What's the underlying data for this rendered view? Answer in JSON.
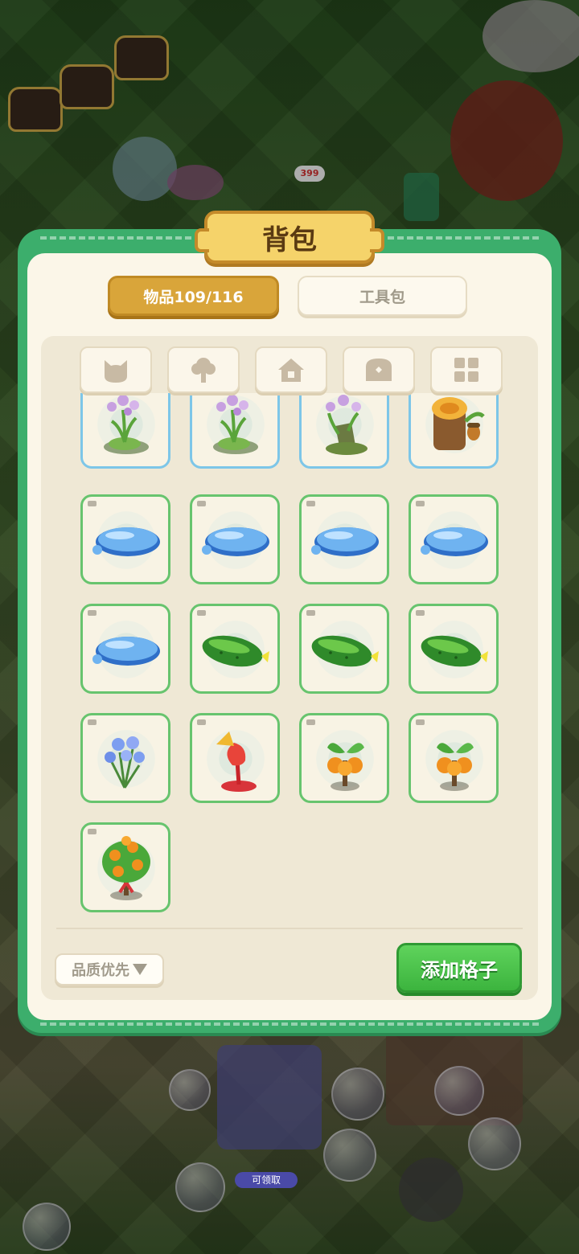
{
  "scene": {
    "price_tag": "399",
    "claim_label": "可领取"
  },
  "panel": {
    "title": "背包",
    "tabs": [
      {
        "label": "物品109/116",
        "active": true
      },
      {
        "label": "工具包",
        "active": false
      }
    ],
    "filters": [
      {
        "icon": "cat-icon"
      },
      {
        "icon": "tree-icon"
      },
      {
        "icon": "house-icon"
      },
      {
        "icon": "chest-icon"
      },
      {
        "icon": "grid-icon"
      }
    ],
    "items": [
      {
        "icon": "orchid-on-rock-icon",
        "border": "blue"
      },
      {
        "icon": "orchid-on-rock-icon",
        "border": "blue"
      },
      {
        "icon": "orchid-on-stump-icon",
        "border": "blue"
      },
      {
        "icon": "tree-stump-acorn-icon",
        "border": "blue"
      },
      {
        "icon": "water-puddle-icon",
        "border": "green"
      },
      {
        "icon": "water-puddle-icon",
        "border": "green"
      },
      {
        "icon": "water-puddle-icon",
        "border": "green"
      },
      {
        "icon": "water-puddle-icon",
        "border": "green"
      },
      {
        "icon": "water-puddle-icon",
        "border": "green"
      },
      {
        "icon": "cucumber-icon",
        "border": "green"
      },
      {
        "icon": "cucumber-icon",
        "border": "green"
      },
      {
        "icon": "cucumber-icon",
        "border": "green"
      },
      {
        "icon": "blue-flowers-icon",
        "border": "green"
      },
      {
        "icon": "red-flower-icon",
        "border": "green"
      },
      {
        "icon": "orange-sapling-icon",
        "border": "green"
      },
      {
        "icon": "orange-sapling-icon",
        "border": "green"
      },
      {
        "icon": "orange-tree-icon",
        "border": "green"
      }
    ],
    "sort_label": "品质优先",
    "add_button_label": "添加格子"
  },
  "colors": {
    "panel_green": "#3cae6c",
    "tab_active": "#d9a53a",
    "add_button": "#3cb43e",
    "rare_border": "#7dc6e8",
    "common_border": "#67c46e"
  }
}
